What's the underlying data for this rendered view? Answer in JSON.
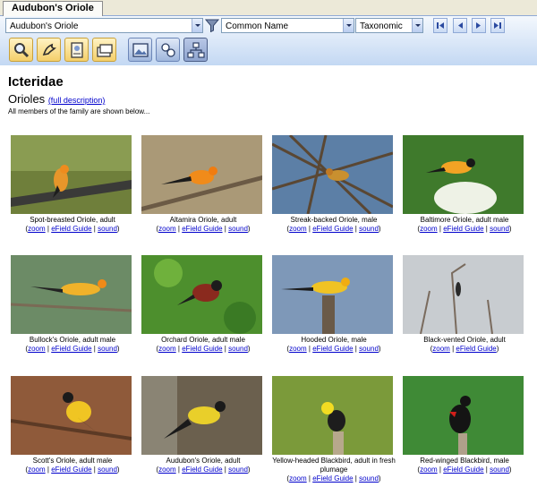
{
  "window": {
    "tab_title": "Audubon's Oriole"
  },
  "toolbar": {
    "species_value": "Audubon's Oriole",
    "name_mode_value": "Common Name",
    "sort_value": "Taxonomic"
  },
  "page": {
    "family": "Icteridae",
    "group": "Orioles",
    "full_description": "(full description)",
    "note": "All members of the family are shown below..."
  },
  "link_labels": {
    "zoom": "zoom",
    "efield": "eField Guide",
    "sound": "sound"
  },
  "cards": [
    {
      "caption": "Spot-breasted Oriole, adult",
      "has_sound": true
    },
    {
      "caption": "Altamira Oriole, adult",
      "has_sound": true
    },
    {
      "caption": "Streak-backed Oriole, male",
      "has_sound": true
    },
    {
      "caption": "Baltimore Oriole, adult male",
      "has_sound": true
    },
    {
      "caption": "Bullock's Oriole, adult male",
      "has_sound": true
    },
    {
      "caption": "Orchard Oriole, adult male",
      "has_sound": true
    },
    {
      "caption": "Hooded Oriole, male",
      "has_sound": true
    },
    {
      "caption": "Black-vented Oriole, adult",
      "has_sound": false
    },
    {
      "caption": "Scott's Oriole, adult male",
      "has_sound": true
    },
    {
      "caption": "Audubon's Oriole, adult",
      "has_sound": true
    },
    {
      "caption": "Yellow-headed Blackbird, adult in fresh plumage",
      "has_sound": true
    },
    {
      "caption": "Red-winged Blackbird, male",
      "has_sound": true
    }
  ]
}
